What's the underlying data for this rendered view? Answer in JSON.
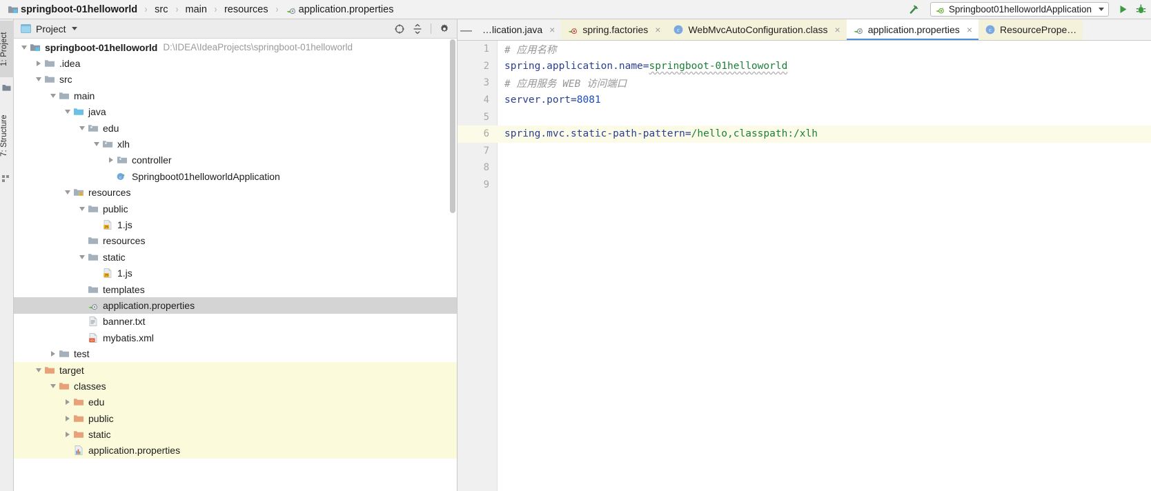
{
  "window": {
    "breadcrumb": [
      {
        "label": "springboot-01helloworld",
        "icon": "module-icon",
        "bold": true
      },
      {
        "label": "src",
        "icon": null,
        "bold": false
      },
      {
        "label": "main",
        "icon": null,
        "bold": false
      },
      {
        "label": "resources",
        "icon": null,
        "bold": false
      },
      {
        "label": "application.properties",
        "icon": "spring-properties-icon",
        "bold": false
      }
    ],
    "separator": "›"
  },
  "toolbar": {
    "build_icon": "hammer-icon",
    "run_configuration": "Springboot01helloworldApplication",
    "run_config_icon": "spring-boot-icon",
    "run_icon": "run-play-icon",
    "debug_icon": "debug-bug-icon"
  },
  "left_strip": {
    "tabs": [
      {
        "label": "1: Project",
        "active": true,
        "icon": "project-icon"
      },
      {
        "label": "7: Structure",
        "active": false,
        "icon": "structure-icon"
      }
    ]
  },
  "project_panel": {
    "title": "Project",
    "title_icon": "project-view-icon",
    "dropdown_icon": "chevron-down-icon",
    "actions": [
      {
        "name": "locate-target-icon",
        "tooltip": "Select Opened File"
      },
      {
        "name": "collapse-all-icon",
        "tooltip": "Collapse All"
      },
      {
        "name": "gear-icon",
        "tooltip": "Settings"
      }
    ],
    "tree": [
      {
        "label": "springboot-01helloworld",
        "path": "D:\\IDEA\\IdeaProjects\\springboot-01helloworld",
        "depth": 0,
        "twist": "down",
        "icon": "module-icon",
        "bold": true,
        "state": "normal"
      },
      {
        "label": ".idea",
        "depth": 1,
        "twist": "right",
        "icon": "folder-grey-icon",
        "state": "normal"
      },
      {
        "label": "src",
        "depth": 1,
        "twist": "down",
        "icon": "folder-grey-icon",
        "state": "normal"
      },
      {
        "label": "main",
        "depth": 2,
        "twist": "down",
        "icon": "folder-grey-icon",
        "state": "normal"
      },
      {
        "label": "java",
        "depth": 3,
        "twist": "down",
        "icon": "folder-source-blue-icon",
        "state": "normal"
      },
      {
        "label": "edu",
        "depth": 4,
        "twist": "down",
        "icon": "package-icon",
        "state": "normal"
      },
      {
        "label": "xlh",
        "depth": 5,
        "twist": "down",
        "icon": "package-icon",
        "state": "normal"
      },
      {
        "label": "controller",
        "depth": 6,
        "twist": "right",
        "icon": "package-icon",
        "state": "normal"
      },
      {
        "label": "Springboot01helloworldApplication",
        "depth": 6,
        "twist": "none",
        "icon": "spring-class-runnable-icon",
        "state": "normal"
      },
      {
        "label": "resources",
        "depth": 3,
        "twist": "down",
        "icon": "folder-resource-icon",
        "state": "normal"
      },
      {
        "label": "public",
        "depth": 4,
        "twist": "down",
        "icon": "folder-grey-icon",
        "state": "normal"
      },
      {
        "label": "1.js",
        "depth": 5,
        "twist": "none",
        "icon": "js-file-icon",
        "state": "normal"
      },
      {
        "label": "resources",
        "depth": 4,
        "twist": "none",
        "icon": "folder-grey-icon",
        "state": "normal"
      },
      {
        "label": "static",
        "depth": 4,
        "twist": "down",
        "icon": "folder-grey-icon",
        "state": "normal"
      },
      {
        "label": "1.js",
        "depth": 5,
        "twist": "none",
        "icon": "js-file-icon",
        "state": "normal"
      },
      {
        "label": "templates",
        "depth": 4,
        "twist": "none",
        "icon": "folder-grey-icon",
        "state": "normal"
      },
      {
        "label": "application.properties",
        "depth": 4,
        "twist": "none",
        "icon": "spring-properties-icon",
        "state": "selected"
      },
      {
        "label": "banner.txt",
        "depth": 4,
        "twist": "none",
        "icon": "txt-file-icon",
        "state": "normal"
      },
      {
        "label": "mybatis.xml",
        "depth": 4,
        "twist": "none",
        "icon": "xml-file-icon",
        "state": "normal"
      },
      {
        "label": "test",
        "depth": 2,
        "twist": "right",
        "icon": "folder-grey-icon",
        "state": "normal"
      },
      {
        "label": "target",
        "depth": 1,
        "twist": "down",
        "icon": "folder-orange-icon",
        "state": "target"
      },
      {
        "label": "classes",
        "depth": 2,
        "twist": "down",
        "icon": "folder-orange-icon",
        "state": "target"
      },
      {
        "label": "edu",
        "depth": 3,
        "twist": "right",
        "icon": "folder-orange-icon",
        "state": "target"
      },
      {
        "label": "public",
        "depth": 3,
        "twist": "right",
        "icon": "folder-orange-icon",
        "state": "target"
      },
      {
        "label": "static",
        "depth": 3,
        "twist": "right",
        "icon": "folder-orange-icon",
        "state": "target"
      },
      {
        "label": "application.properties",
        "depth": 3,
        "twist": "none",
        "icon": "properties-file-icon",
        "state": "target"
      }
    ]
  },
  "editor": {
    "collapse_icon": "minimize-icon",
    "tabs": [
      {
        "label": "…lication.java",
        "icon": null,
        "active": false,
        "style": "plain",
        "close": "×"
      },
      {
        "label": "spring.factories",
        "icon": "spring-icon",
        "active": false,
        "style": "yellow",
        "close": "×"
      },
      {
        "label": "WebMvcAutoConfiguration.class",
        "icon": "class-icon",
        "active": false,
        "style": "yellow",
        "close": "×"
      },
      {
        "label": "application.properties",
        "icon": "spring-properties-icon",
        "active": true,
        "style": "active",
        "close": "×"
      },
      {
        "label": "ResourcePrope…",
        "icon": "class-icon",
        "active": false,
        "style": "yellow",
        "close": ""
      }
    ],
    "line_numbers": [
      "1",
      "2",
      "3",
      "4",
      "5",
      "6",
      "7",
      "8",
      "9"
    ],
    "highlight_line": 6,
    "lines": [
      {
        "n": "1",
        "tokens": [
          {
            "t": "# 应用名称",
            "c": "c-comment"
          }
        ]
      },
      {
        "n": "2",
        "tokens": [
          {
            "t": "spring.application.name",
            "c": "c-key"
          },
          {
            "t": "=",
            "c": "c-eq"
          },
          {
            "t": "springboot-01helloworld",
            "c": "c-val wavy"
          }
        ]
      },
      {
        "n": "3",
        "tokens": [
          {
            "t": "# 应用服务 WEB 访问端口",
            "c": "c-comment"
          }
        ]
      },
      {
        "n": "4",
        "tokens": [
          {
            "t": "server.port",
            "c": "c-key"
          },
          {
            "t": "=",
            "c": "c-eq"
          },
          {
            "t": "8081",
            "c": "c-num"
          }
        ]
      },
      {
        "n": "5",
        "tokens": []
      },
      {
        "n": "6",
        "tokens": [
          {
            "t": "spring.mvc.static-path-pattern",
            "c": "c-key"
          },
          {
            "t": "=",
            "c": "c-eq"
          },
          {
            "t": "/hello,classpath:/xlh",
            "c": "c-val"
          }
        ]
      },
      {
        "n": "7",
        "tokens": []
      },
      {
        "n": "8",
        "tokens": []
      },
      {
        "n": "9",
        "tokens": []
      }
    ]
  },
  "colors": {
    "accent_blue": "#4a90d9",
    "folder_orange": "#e8a27a",
    "folder_grey": "#a4b0bc",
    "source_blue": "#6ac0e8",
    "spring_green": "#6db33f",
    "comment_grey": "#969696",
    "key_blue": "#2a3f8f",
    "value_green": "#1a7f37",
    "number_blue": "#1a49c4",
    "selection_grey": "#d4d4d4",
    "target_yellow": "#fbfbdc",
    "caret_line": "#fcfbe8"
  }
}
